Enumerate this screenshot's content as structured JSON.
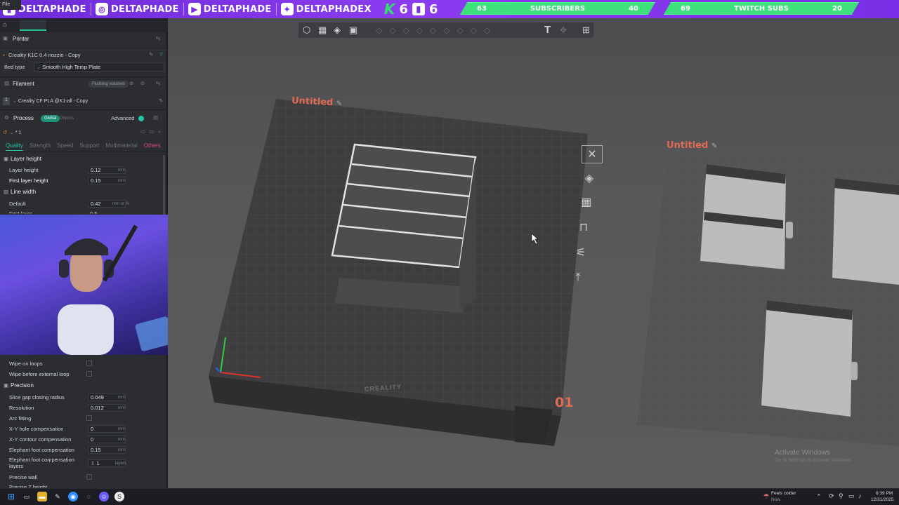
{
  "overlay": {
    "handles": [
      {
        "icon": "twitch-icon",
        "name": "DELTAPHADE"
      },
      {
        "icon": "instagram-icon",
        "name": "DELTAPHADE"
      },
      {
        "icon": "youtube-icon",
        "name": "DELTAPHADE"
      },
      {
        "icon": "twitter-icon",
        "name": "DELTAPHADEX"
      }
    ],
    "kick_count": "6",
    "twitch_count": "6",
    "goals": [
      {
        "current": "63",
        "label": "SUBSCRIBERS",
        "target": "40",
        "fraction": 1.0
      },
      {
        "current": "69",
        "label": "TWITCH SUBS",
        "target": "20",
        "fraction": 1.0
      }
    ]
  },
  "app": {
    "menu_file": "File"
  },
  "left_panel": {
    "printer_header": "Printer",
    "printer_name": "Creality K1C 0.4 nozzle - Copy",
    "bed_type_label": "Bed type",
    "bed_type_value": "Smooth High Temp Plate",
    "filament_header": "Filament",
    "flushing_volumes": "Flushing volumes",
    "filament_index": "1",
    "filament_name": "Creality CF PLA @K1-all - Copy",
    "process_header": "Process",
    "global_pill": "Global",
    "objects_pill": "Objects",
    "advanced_label": "Advanced",
    "preset_name": "* 1",
    "tabs": [
      "Quality",
      "Strength",
      "Speed",
      "Support",
      "Multimaterial",
      "Others"
    ],
    "layer_height_group": "Layer height",
    "layer_height_label": "Layer height",
    "layer_height_value": "0.12",
    "first_layer_height_label": "First layer height",
    "first_layer_height_value": "0.15",
    "line_width_group": "Line width",
    "default_label": "Default",
    "default_value": "0.42",
    "default_unit": "mm or %",
    "first_layer_label": "First layer",
    "first_layer_value": "0.5",
    "unit_mm": "mm",
    "wipe_on_loops": "Wipe on loops",
    "wipe_before_external": "Wipe before external loop",
    "precision_group": "Precision",
    "slice_gap_label": "Slice gap closing radius",
    "slice_gap_value": "0.049",
    "resolution_label": "Resolution",
    "resolution_value": "0.012",
    "arc_fitting_label": "Arc fitting",
    "xy_hole_label": "X-Y hole compensation",
    "xy_hole_value": "0",
    "xy_contour_label": "X-Y contour compensation",
    "xy_contour_value": "0",
    "elephant_label": "Elephant foot compensation",
    "elephant_value": "0.15",
    "elephant_layers_label": "Elephant foot compensation layers",
    "elephant_layers_value": "1",
    "elephant_layers_unit": "layers",
    "precise_wall_label": "Precise wall",
    "precise_z_label": "Precise Z height"
  },
  "viewport": {
    "plate1_label": "Untitled",
    "plate2_label": "Untitled",
    "plate_number": "01",
    "bed_brand": "CREALITY",
    "activate_title": "Activate Windows",
    "activate_sub": "Go to Settings to activate Windows."
  },
  "taskbar": {
    "weather": "Feels colder",
    "weather_sub": "Now",
    "time": "8:39 PM",
    "date": "12/31/2025"
  }
}
